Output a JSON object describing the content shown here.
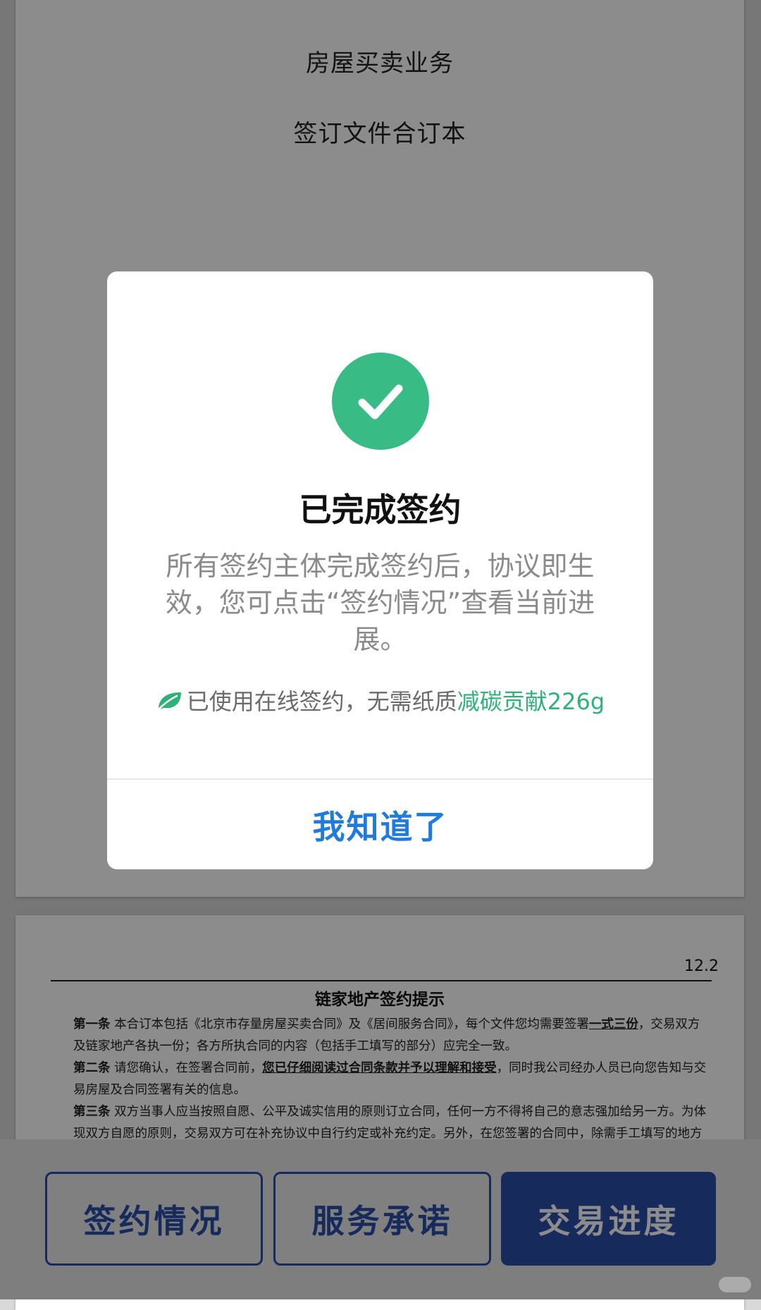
{
  "cover": {
    "line1": "房屋买卖业务",
    "line2": "签订文件合订本"
  },
  "document": {
    "page_number": "12.2",
    "title": "链家地产签约提示",
    "clauses": [
      {
        "label": "第一条",
        "text_before": "本合订本包括《北京市存量房屋买卖合同》及《居间服务合同》，每个文件您均需要签署",
        "emphasis": "一式三份",
        "text_after": "，交易双方及链家地产各执一份；各方所执合同的内容（包括手工填写的部分）应完全一致。"
      },
      {
        "label": "第二条",
        "text_before": "请您确认，在签署合同前，",
        "emphasis": "您已仔细阅读过合同条款并予以理解和接受",
        "text_after": "，同时我公司经办人员已向您告知与交易房屋及合同签署有关的信息。"
      },
      {
        "label": "第三条",
        "text_before": "双方当事人应当按照自愿、公平及诚实信用的原则订立合同，任何一方不得将自己的意志强加给另一方。为体现双方自愿的原则，交易双方可在补充协议中自行约定或补充约定。另外，在您签署的合同中，除需手工填写的地方",
        "emphasis": "",
        "text_after": ""
      }
    ]
  },
  "dialog": {
    "icon": "check-circle-icon",
    "title": "已完成签约",
    "message": "所有签约主体完成签约后，协议即生效，您可点击“签约情况”查看当前进展。",
    "eco_prefix": "已使用在线签约，无需纸质",
    "eco_highlight": "减碳贡献226g",
    "confirm_label": "我知道了"
  },
  "bottom_bar": {
    "signing_status": "签约情况",
    "service_promise": "服务承诺",
    "transaction_progress": "交易进度"
  },
  "colors": {
    "success_green": "#39bb86",
    "eco_green": "#2fb27a",
    "link_blue": "#1f7bdc",
    "brand_blue": "#2b4ea8"
  }
}
